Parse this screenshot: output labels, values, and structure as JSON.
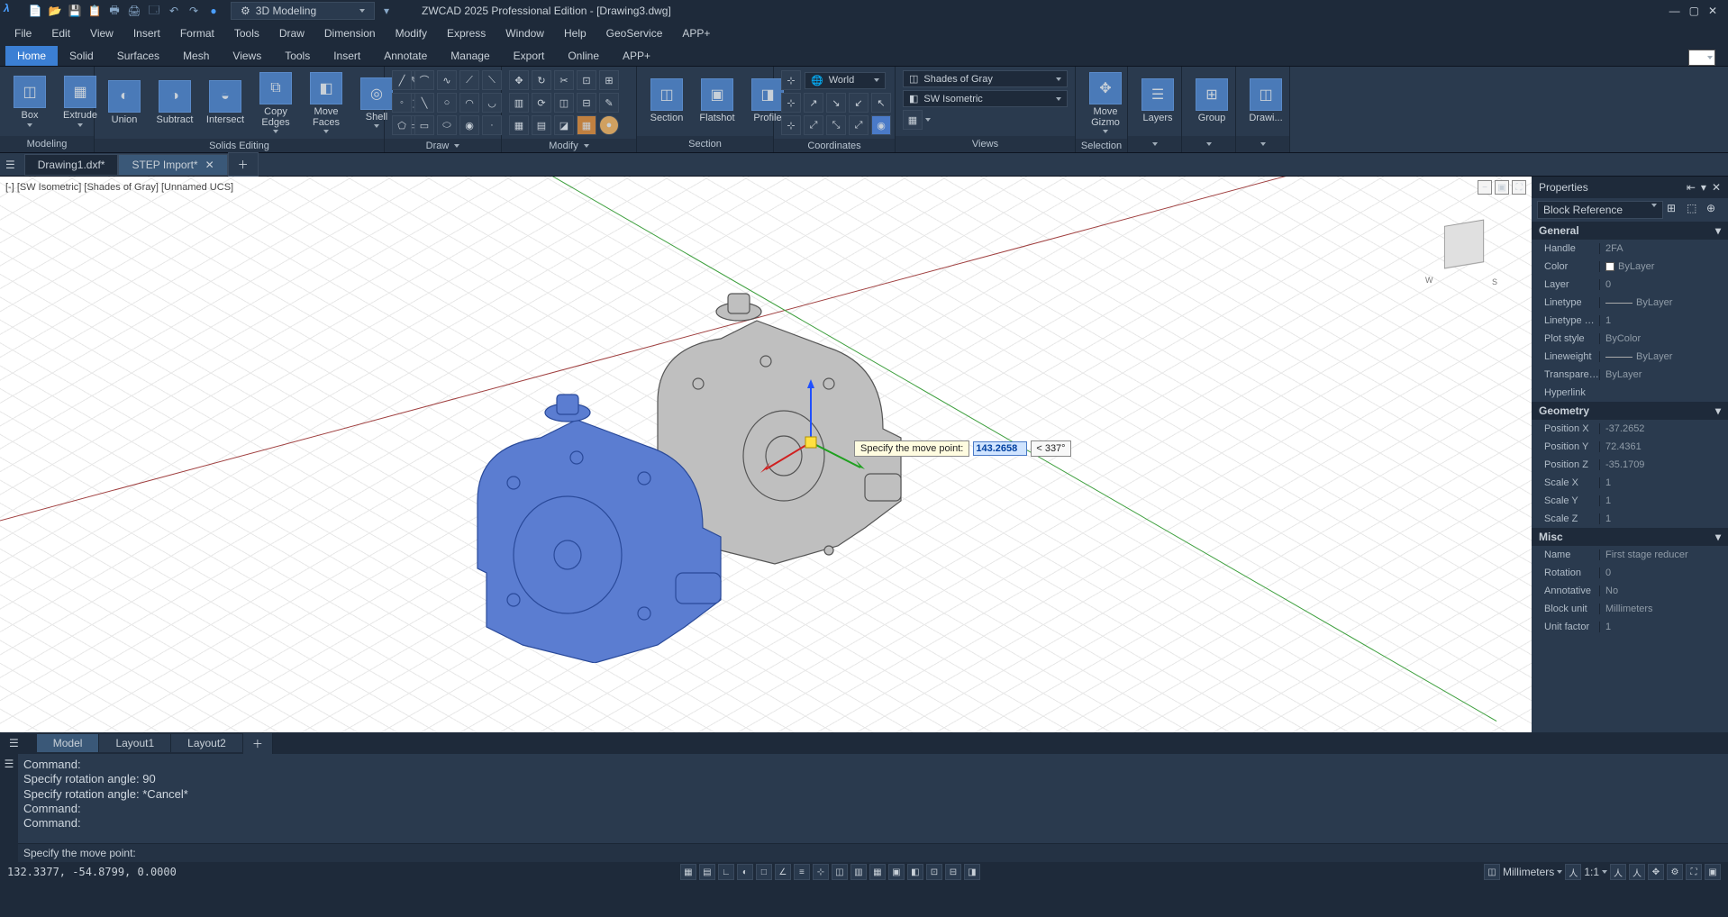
{
  "app": {
    "title": "ZWCAD 2025 Professional Edition - [Drawing3.dwg]",
    "workspace": "3D Modeling"
  },
  "menus": [
    "File",
    "Edit",
    "View",
    "Insert",
    "Format",
    "Tools",
    "Draw",
    "Dimension",
    "Modify",
    "Express",
    "Window",
    "Help",
    "GeoService",
    "APP+"
  ],
  "ribbon_tabs": [
    "Home",
    "Solid",
    "Surfaces",
    "Mesh",
    "Views",
    "Tools",
    "Insert",
    "Annotate",
    "Manage",
    "Export",
    "Online",
    "APP+"
  ],
  "ribbon_active": 0,
  "panels": {
    "modeling": {
      "title": "Modeling",
      "btns": [
        "Box",
        "Extrude"
      ]
    },
    "solids_editing": {
      "title": "Solids Editing",
      "btns": [
        "Union",
        "Subtract",
        "Intersect",
        "Copy Edges",
        "Move Faces",
        "Shell"
      ]
    },
    "draw": {
      "title": "Draw"
    },
    "modify": {
      "title": "Modify"
    },
    "section": {
      "title": "Section",
      "btns": [
        "Section",
        "Flatshot",
        "Profile"
      ]
    },
    "coordinates": {
      "title": "Coordinates",
      "ucs": "World"
    },
    "views": {
      "title": "Views",
      "style": "Shades of Gray",
      "view": "SW Isometric"
    },
    "selection": {
      "title": "Selection",
      "btn": "Move Gizmo"
    },
    "layers": {
      "title": "",
      "btn": "Layers"
    },
    "group": {
      "title": "",
      "btn": "Group"
    },
    "drawing": {
      "title": "",
      "btn": "Drawi..."
    }
  },
  "doc_tabs": [
    "Drawing1.dxf*",
    "STEP Import*"
  ],
  "doc_active": 1,
  "viewport": {
    "label": "[-] [SW Isometric] [Shades of Gray] [Unnamed UCS]",
    "prompt": "Specify the move point:",
    "dist": "143.2658",
    "angle": "< 337°"
  },
  "properties": {
    "title": "Properties",
    "type": "Block Reference",
    "sections": {
      "General": [
        {
          "k": "Handle",
          "v": "2FA"
        },
        {
          "k": "Color",
          "v": "ByLayer",
          "swatch": true
        },
        {
          "k": "Layer",
          "v": "0"
        },
        {
          "k": "Linetype",
          "v": "ByLayer",
          "line": true
        },
        {
          "k": "Linetype sc...",
          "v": "1"
        },
        {
          "k": "Plot style",
          "v": "ByColor"
        },
        {
          "k": "Lineweight",
          "v": "ByLayer",
          "line": true
        },
        {
          "k": "Transparen...",
          "v": "ByLayer"
        },
        {
          "k": "Hyperlink",
          "v": ""
        }
      ],
      "Geometry": [
        {
          "k": "Position X",
          "v": "-37.2652"
        },
        {
          "k": "Position Y",
          "v": "72.4361"
        },
        {
          "k": "Position Z",
          "v": "-35.1709"
        },
        {
          "k": "Scale X",
          "v": "1"
        },
        {
          "k": "Scale Y",
          "v": "1"
        },
        {
          "k": "Scale Z",
          "v": "1"
        }
      ],
      "Misc": [
        {
          "k": "Name",
          "v": "First stage reducer"
        },
        {
          "k": "Rotation",
          "v": "0"
        },
        {
          "k": "Annotative",
          "v": "No"
        },
        {
          "k": "Block unit",
          "v": "Millimeters"
        },
        {
          "k": "Unit factor",
          "v": "1"
        }
      ]
    }
  },
  "layout_tabs": [
    "Model",
    "Layout1",
    "Layout2"
  ],
  "layout_active": 0,
  "command": {
    "history": [
      "Command:",
      "Specify rotation angle: 90",
      "Specify rotation angle: *Cancel*",
      "Command:",
      "Command:"
    ],
    "prompt": "Specify the move point:"
  },
  "status": {
    "coords": "132.3377, -54.8799, 0.0000",
    "units": "Millimeters",
    "scale": "1:1"
  }
}
